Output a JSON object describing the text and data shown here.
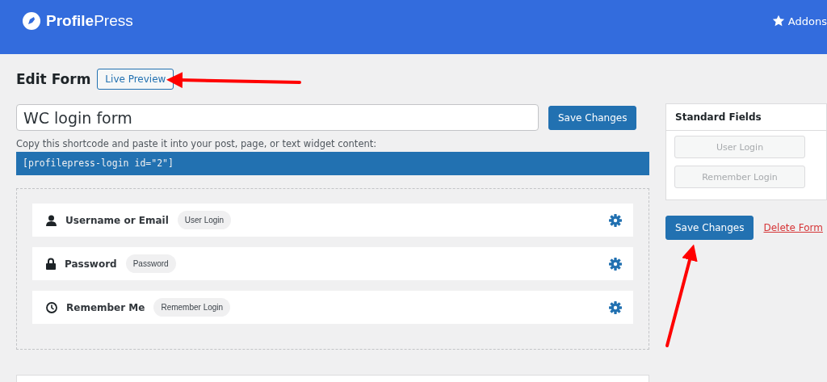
{
  "header": {
    "brand_bold": "Profile",
    "brand_light": "Press",
    "addons": "Addons"
  },
  "page": {
    "title": "Edit Form",
    "preview_button": "Live Preview"
  },
  "form_name": {
    "value": "WC login form"
  },
  "save_button": "Save Changes",
  "shortcode": {
    "hint": "Copy this shortcode and paste it into your post, page, or text widget content:",
    "code": "[profilepress-login id=\"2\"]"
  },
  "fields": [
    {
      "kind": "user",
      "label": "Username or Email",
      "tag": "User Login"
    },
    {
      "kind": "lock",
      "label": "Password",
      "tag": "Password"
    },
    {
      "kind": "clock",
      "label": "Remember Me",
      "tag": "Remember Login"
    }
  ],
  "sidebar": {
    "title": "Standard Fields",
    "items": [
      {
        "label": "User Login",
        "disabled": true
      },
      {
        "label": "Remember Login",
        "disabled": true
      }
    ],
    "save_button": "Save Changes",
    "delete_link": "Delete Form"
  }
}
